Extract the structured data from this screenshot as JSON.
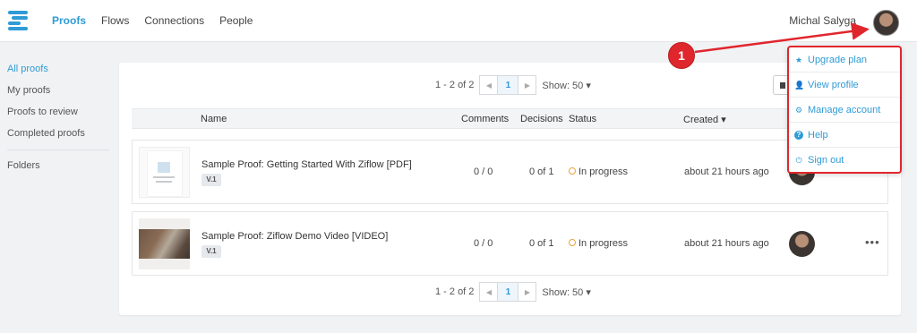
{
  "nav": {
    "items": [
      {
        "label": "Proofs",
        "active": true
      },
      {
        "label": "Flows",
        "active": false
      },
      {
        "label": "Connections",
        "active": false
      },
      {
        "label": "People",
        "active": false
      }
    ],
    "username": "Michal Salyga"
  },
  "sidebar": {
    "items": [
      {
        "label": "All proofs",
        "active": true
      },
      {
        "label": "My proofs",
        "active": false
      },
      {
        "label": "Proofs to review",
        "active": false
      },
      {
        "label": "Completed proofs",
        "active": false
      }
    ],
    "folders_label": "Folders"
  },
  "pager_top": {
    "range": "1 - 2 of 2",
    "prev": "◀",
    "page": "1",
    "next": "▶",
    "show": "Show: 50 ▾"
  },
  "pager_bottom": {
    "range": "1 - 2 of 2",
    "prev": "◀",
    "page": "1",
    "next": "▶",
    "show": "Show: 50 ▾"
  },
  "table": {
    "headers": {
      "name": "Name",
      "comments": "Comments",
      "decisions": "Decisions",
      "status": "Status",
      "created": "Created ▾"
    },
    "rows": [
      {
        "name": "Sample Proof: Getting Started With Ziflow [PDF]",
        "version": "V.1",
        "comments": "0 / 0",
        "decisions": "0 of 1",
        "status": "In progress",
        "created": "about 21 hours ago"
      },
      {
        "name": "Sample Proof: Ziflow Demo Video [VIDEO]",
        "version": "V.1",
        "comments": "0 / 0",
        "decisions": "0 of 1",
        "status": "In progress",
        "created": "about 21 hours ago",
        "more": "•••"
      }
    ]
  },
  "dropdown": {
    "items": [
      {
        "label": "Upgrade plan",
        "icon": "★"
      },
      {
        "label": "View profile",
        "icon": "👤"
      },
      {
        "label": "Manage account",
        "icon": "⚙"
      },
      {
        "label": "Help",
        "icon": "?"
      },
      {
        "label": "Sign out",
        "icon": "⏻"
      }
    ]
  },
  "annotation": {
    "step": "1"
  },
  "colors": {
    "accent": "#2f9bd6",
    "annotation_red": "#e0262d",
    "status_orange": "#e8a33a"
  }
}
